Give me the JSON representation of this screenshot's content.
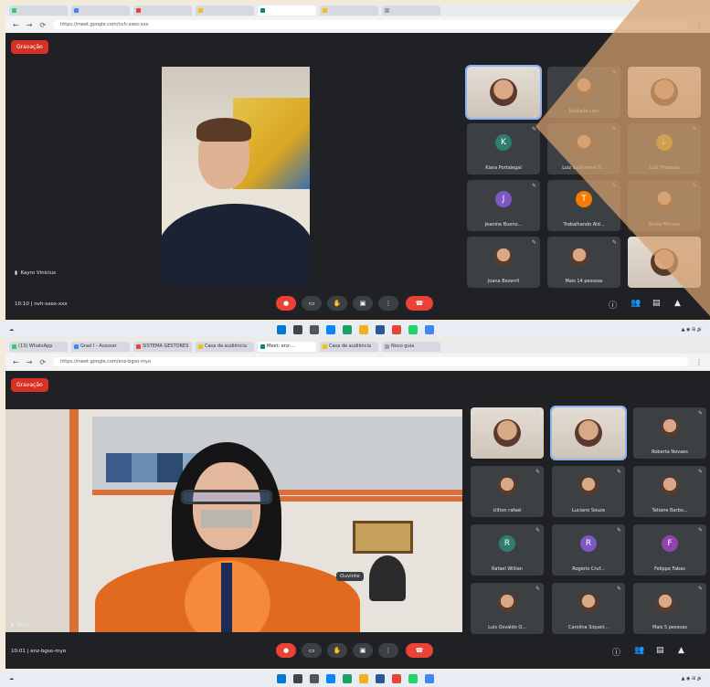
{
  "top": {
    "url": "https://meet.google.com/nvh-sxex-xxx",
    "recording_label": "Gravação",
    "presenter_name": "Kayro Vinicius",
    "time_meeting": "10:10  |  nvh-sxex-xxx",
    "tiles": [
      {
        "name": "",
        "kind": "photo",
        "active": true
      },
      {
        "name": "Nathalia Lion",
        "kind": "photo"
      },
      {
        "name": "",
        "kind": "photo"
      },
      {
        "name": "Kiara Portalegal",
        "kind": "avatar",
        "letter": "K",
        "color": "#2e7d6e"
      },
      {
        "name": "Luiz Guilherme O...",
        "kind": "photo"
      },
      {
        "name": "Luiz Trindade",
        "kind": "avatar",
        "letter": "L",
        "color": "#c0a300"
      },
      {
        "name": "Jeanine Bueno...",
        "kind": "avatar",
        "letter": "J",
        "color": "#7e57c2"
      },
      {
        "name": "Trabalhando Ald...",
        "kind": "avatar",
        "letter": "T",
        "color": "#f57c00"
      },
      {
        "name": "Bruna Moraes",
        "kind": "photo"
      },
      {
        "name": "Joana Bezerril",
        "kind": "photo"
      },
      {
        "name": "Mais 14 pessoas",
        "kind": "group"
      },
      {
        "name": "",
        "kind": "photo"
      }
    ]
  },
  "bottom": {
    "tabs": [
      "(13) WhatsApp",
      "Grad I - Acessar",
      "SISTEMA GESTORES",
      "Casa da audiência",
      "Meet: enz-...",
      "Casa de audiência",
      "Novo guia"
    ],
    "url": "https://meet.google.com/enz-bgso-myo",
    "recording_label": "Gravação",
    "presenter_name": "Raiza",
    "overlay_label": "Ouvinte",
    "time_meeting": "10:01  |  enz-bgso-myo",
    "tiles": [
      {
        "name": "",
        "kind": "photo"
      },
      {
        "name": "",
        "kind": "photo",
        "active": true
      },
      {
        "name": "Roberta Novaes",
        "kind": "photo"
      },
      {
        "name": "clilton rafael",
        "kind": "photo"
      },
      {
        "name": "Luciano Souza",
        "kind": "photo"
      },
      {
        "name": "Tatiane Barbo...",
        "kind": "photo"
      },
      {
        "name": "Rafael Willian",
        "kind": "avatar",
        "letter": "R",
        "color": "#2e7d6e"
      },
      {
        "name": "Rogério Cruf...",
        "kind": "avatar",
        "letter": "R",
        "color": "#7e57c2"
      },
      {
        "name": "Felippe Fabas",
        "kind": "avatar",
        "letter": "F",
        "color": "#8e44ad"
      },
      {
        "name": "Luis Osvaldo O...",
        "kind": "photo"
      },
      {
        "name": "Carolina Siqueir...",
        "kind": "photo"
      },
      {
        "name": "Mais 5 pessoas",
        "kind": "group"
      }
    ]
  },
  "icons": {
    "mic": "mic-off-icon",
    "cam": "camera-icon",
    "hand": "raise-hand-icon",
    "present": "present-icon",
    "more": "more-icon",
    "end": "end-call-icon"
  }
}
